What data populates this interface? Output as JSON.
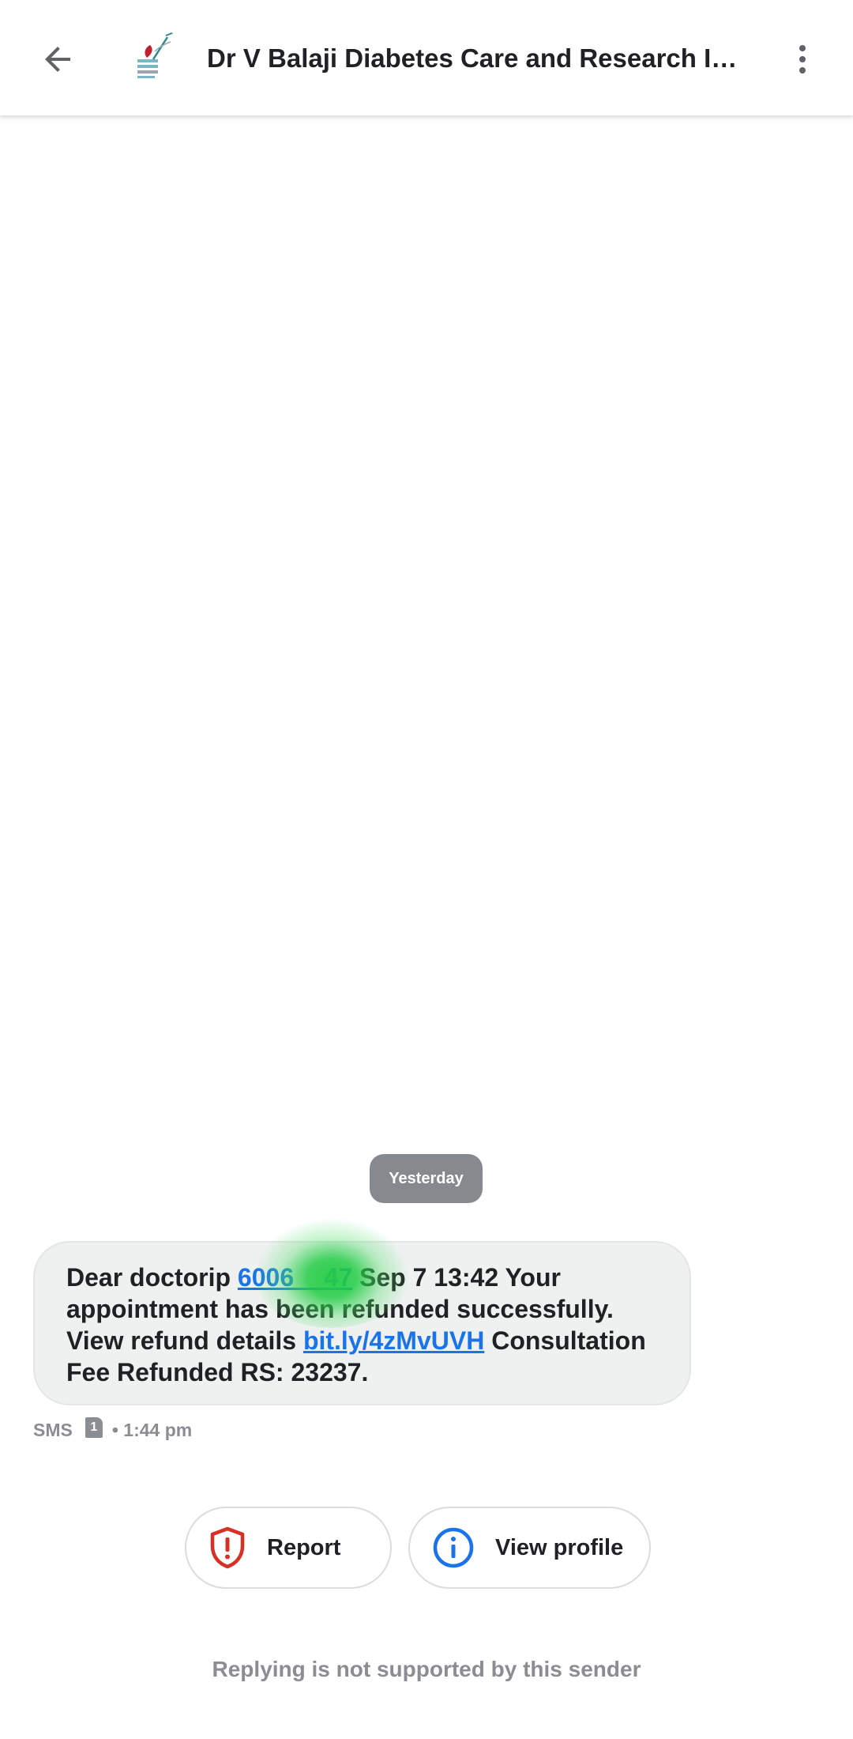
{
  "header": {
    "title": "Dr V Balaji Diabetes Care and Research Ins…",
    "back_icon": "arrow-back-icon",
    "more_icon": "more-vert-icon",
    "avatar_icon": "sender-logo"
  },
  "conversation": {
    "day_label": "Yesterday",
    "message": {
      "text_before_number": "Dear doctorip ",
      "phone_link": "6006      47",
      "text_after_number": " Sep 7 13:42 Your appointment has been refunded successfully. View refund details ",
      "url_link": "bit.ly/4zMvUVH",
      "text_end": " Consultation Fee Refunded RS: 23237."
    },
    "meta": {
      "channel": "SMS",
      "sim": "1",
      "time": "• 1:44 pm"
    }
  },
  "actions": {
    "report_label": "Report",
    "view_profile_label": "View profile"
  },
  "footer": {
    "note": "Replying is not supported by this sender"
  },
  "colors": {
    "link": "#1a73e8",
    "report_icon": "#d93025",
    "info_icon": "#1a73e8",
    "chip_bg": "#868a8f",
    "bubble_bg": "#eff1f1"
  }
}
